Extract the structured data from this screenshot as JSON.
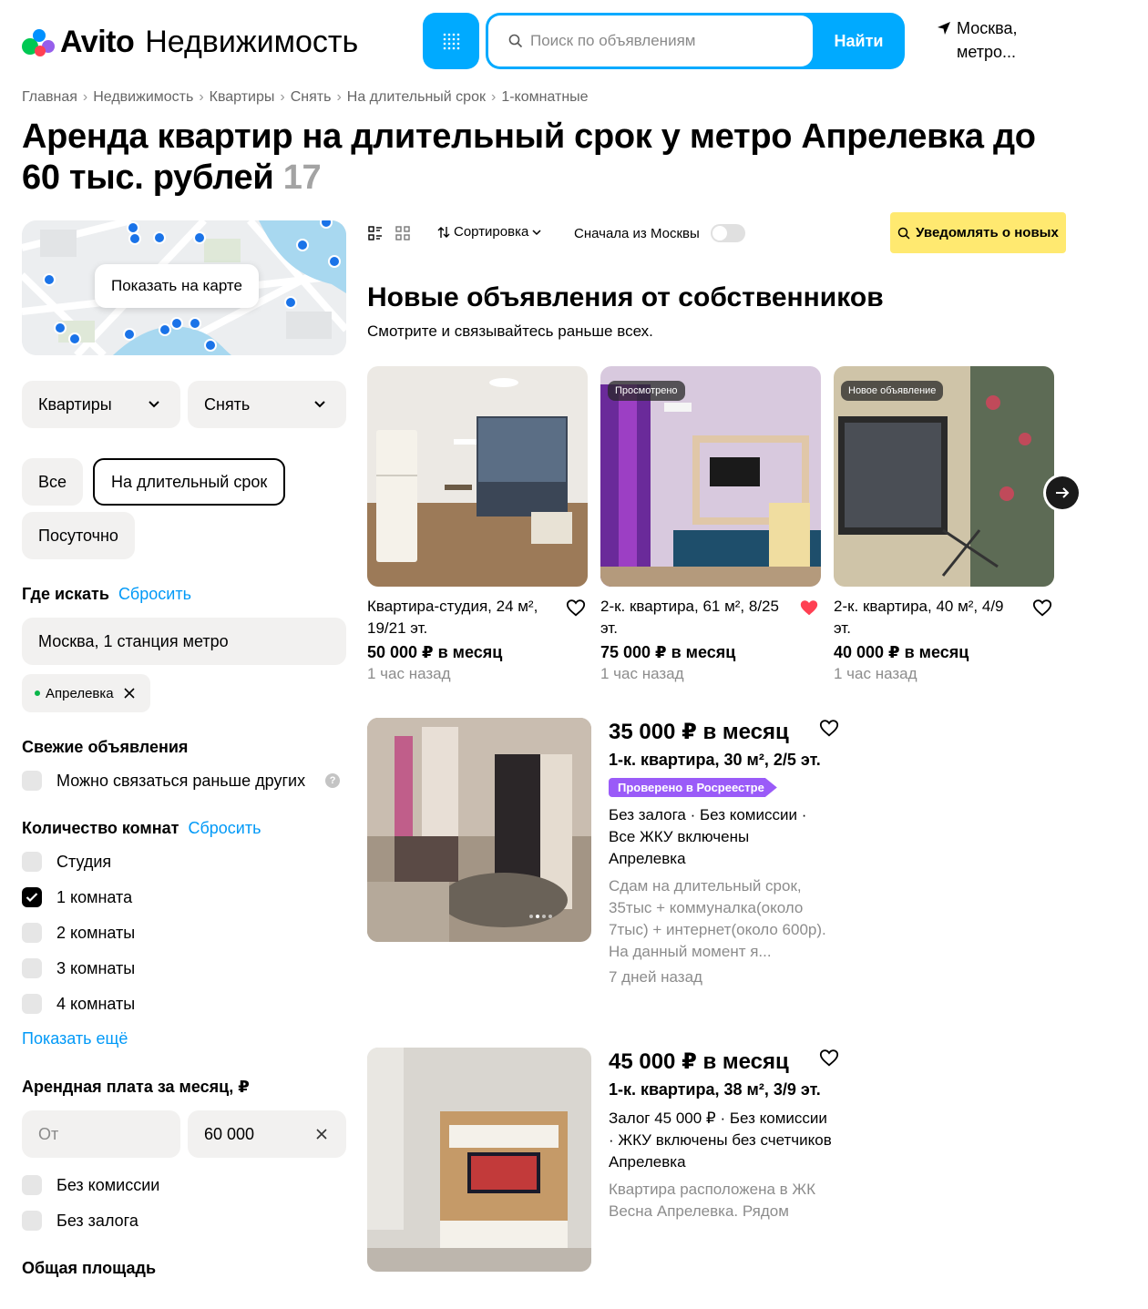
{
  "header": {
    "logo_brand": "Avito",
    "logo_section": "Недвижимость",
    "search_placeholder": "Поиск по объявлениям",
    "search_button": "Найти",
    "location_line1": "Москва,",
    "location_line2": "метро..."
  },
  "breadcrumbs": [
    "Главная",
    "Недвижимость",
    "Квартиры",
    "Снять",
    "На длительный срок",
    "1-комнатные"
  ],
  "page": {
    "title": "Аренда квартир на длительный срок у метро Апрелевка до 60 тыс. рублей",
    "count": "17"
  },
  "filters": {
    "map_button": "Показать на карте",
    "category_select": "Квартиры",
    "deal_select": "Снять",
    "rent_types": [
      "Все",
      "На длительный срок",
      "Посуточно"
    ],
    "where_title": "Где искать",
    "reset_label": "Сбросить",
    "where_value": "Москва, 1 станция метро",
    "metro_tag": "Апрелевка",
    "fresh_title": "Свежие объявления",
    "fresh_option": "Можно связаться раньше других",
    "rooms_title": "Количество комнат",
    "rooms": [
      {
        "label": "Студия",
        "checked": false
      },
      {
        "label": "1 комната",
        "checked": true
      },
      {
        "label": "2 комнаты",
        "checked": false
      },
      {
        "label": "3 комнаты",
        "checked": false
      },
      {
        "label": "4 комнаты",
        "checked": false
      }
    ],
    "show_more": "Показать ещё",
    "price_title": "Арендная плата за месяц, ₽",
    "price_from_placeholder": "От",
    "price_to_value": "60 000",
    "no_commission": "Без комиссии",
    "no_deposit": "Без залога",
    "area_title": "Общая площадь"
  },
  "toolbar": {
    "sort_label": "Сортировка",
    "moscow_first": "Сначала из Москвы",
    "notify_label": "Уведомлять о новых"
  },
  "new_section": {
    "title": "Новые объявления от собственников",
    "subtitle": "Смотрите и связывайтесь раньше всех.",
    "cards": [
      {
        "badge": "",
        "name": "Квартира-студия, 24 м², 19/21 эт.",
        "price": "50 000 ₽ в месяц",
        "time": "1 час назад",
        "favorite": false
      },
      {
        "badge": "Просмотрено",
        "name": "2-к. квартира, 61 м², 8/25 эт.",
        "price": "75 000 ₽ в месяц",
        "time": "1 час назад",
        "favorite": true
      },
      {
        "badge": "Новое объявление",
        "name": "2-к. квартира, 40 м², 4/9 эт.",
        "price": "40 000 ₽ в месяц",
        "time": "1 час назад",
        "favorite": false
      }
    ]
  },
  "listings": [
    {
      "price": "35 000 ₽ в месяц",
      "meta": "1-к. квартира, 30 м², 2/5 эт.",
      "verified": "Проверено в Росреестре",
      "terms": "Без залога · Без комиссии · Все ЖКУ включены",
      "station": "Апрелевка",
      "desc": "Сдам на длительный срок, 35тыс + коммуналка(около 7тыс) + интернет(около 600р). На данный момент я...",
      "ago": "7 дней назад"
    },
    {
      "price": "45 000 ₽ в месяц",
      "meta": "1-к. квартира, 38 м², 3/9 эт.",
      "verified": "",
      "terms": "Залог 45 000 ₽ · Без комиссии · ЖКУ включены без счетчиков",
      "station": "Апрелевка",
      "desc": "Квартира расположена в ЖК Весна Апрелевка. Рядом",
      "ago": ""
    }
  ],
  "colors": {
    "accent": "#00aaff",
    "link": "#0099f7",
    "notify_bg": "#ffe970",
    "verified": "#9a5bf8",
    "favorite": "#ff4053"
  }
}
